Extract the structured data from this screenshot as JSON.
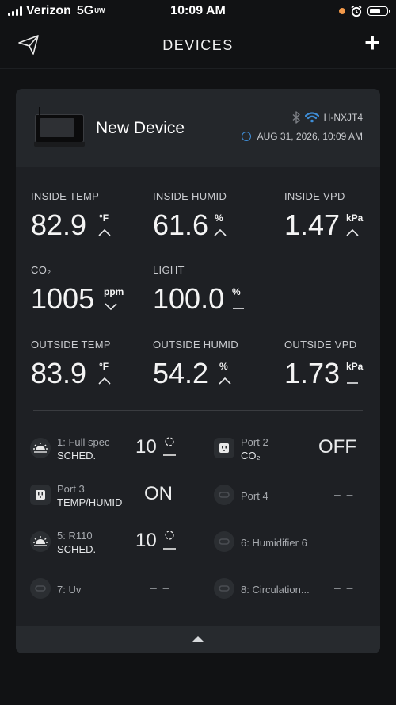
{
  "status_bar": {
    "carrier": "Verizon",
    "network": "5G",
    "network_suffix": "UW",
    "time": "10:09 AM"
  },
  "nav": {
    "title": "DEVICES",
    "add_label": "+"
  },
  "device": {
    "name": "New Device",
    "id": "H-NXJT4",
    "timestamp": "AUG 31, 2026, 10:09 AM"
  },
  "metrics": [
    {
      "label": "INSIDE TEMP",
      "value": "82.9",
      "unit": "°F",
      "trend": "up"
    },
    {
      "label": "INSIDE HUMID",
      "value": "61.6",
      "unit": "%",
      "trend": "up"
    },
    {
      "label": "INSIDE VPD",
      "value": "1.47",
      "unit": "kPa",
      "trend": "up"
    },
    {
      "label": "CO₂",
      "value": "1005",
      "unit": "ppm",
      "trend": "down"
    },
    {
      "label": "LIGHT",
      "value": "100.0",
      "unit": "%",
      "trend": "flat"
    },
    {
      "label": "OUTSIDE TEMP",
      "value": "83.9",
      "unit": "°F",
      "trend": "up"
    },
    {
      "label": "OUTSIDE HUMID",
      "value": "54.2",
      "unit": "%",
      "trend": "up"
    },
    {
      "label": "OUTSIDE VPD",
      "value": "1.73",
      "unit": "kPa",
      "trend": "flat"
    }
  ],
  "ports": [
    {
      "line1": "1: Full spec",
      "line2": "SCHED.",
      "value": "10",
      "icon": "sun-icon"
    },
    {
      "line1": "Port 2",
      "line2": "CO₂",
      "value": "OFF",
      "icon": "outlet-icon"
    },
    {
      "line1": "Port 3",
      "line2": "TEMP/HUMID",
      "value": "ON",
      "icon": "outlet-icon"
    },
    {
      "line1": "Port 4",
      "line2": "",
      "value": "– –",
      "icon": "link-icon"
    },
    {
      "line1": "5: R110",
      "line2": "SCHED.",
      "value": "10",
      "icon": "sun-icon"
    },
    {
      "line1": "6: Humidifier 6",
      "line2": "",
      "value": "– –",
      "icon": "link-icon"
    },
    {
      "line1": "7: Uv",
      "line2": "",
      "value": "– –",
      "icon": "link-icon"
    },
    {
      "line1": "8: Circulation...",
      "line2": "",
      "value": "– –",
      "icon": "link-icon"
    }
  ]
}
